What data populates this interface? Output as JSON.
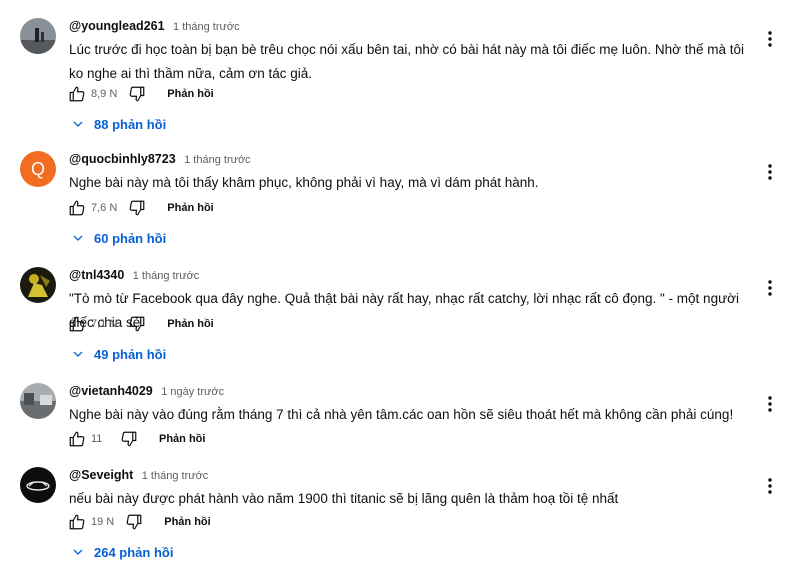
{
  "comments": [
    {
      "author": "@younglead261",
      "time": "1 tháng trước",
      "text": "Lúc trước đi học toàn bị bạn bè trêu chọc nói xấu bên tai, nhờ có bài hát này mà tôi điếc mẹ luôn. Nhờ thế mà tôi ko nghe ai thì thầm nữa, cảm ơn tác giả.",
      "likes": "8,9 N",
      "reply_label": "Phản hồi",
      "replies": "88 phản hồi"
    },
    {
      "author": "@quocbinhly8723",
      "time": "1 tháng trước",
      "avatar_letter": "Q",
      "text": "Nghe bài này mà tôi thấy khâm phục, không phải vì hay, mà vì dám phát hành.",
      "likes": "7,6 N",
      "reply_label": "Phản hồi",
      "replies": "60 phản hồi"
    },
    {
      "author": "@tnl4340",
      "time": "1 tháng trước",
      "text": "\"Tò mò từ Facebook qua đây nghe. Quả thật bài này rất hay, nhạc rất catchy, lời nhạc rất cô đọng. \" - một người điếc chia sẻ",
      "likes": "7,1 N",
      "reply_label": "Phản hồi",
      "replies": "49 phản hồi"
    },
    {
      "author": "@vietanh4029",
      "time": "1 ngày trước",
      "text": "Nghe bài này vào đúng rằm tháng 7 thì cả nhà yên tâm.các oan hồn sẽ siêu thoát hết mà không cần phải cúng!",
      "likes": "11",
      "reply_label": "Phản hồi"
    },
    {
      "author": "@Seveight",
      "time": "1 tháng trước",
      "text": "nếu bài này được phát hành vào năm 1900 thì titanic sẽ bị lãng quên là thảm hoạ tồi tệ nhất",
      "likes": "19 N",
      "reply_label": "Phản hồi",
      "replies": "264 phản hồi"
    }
  ],
  "colors": {
    "link": "#065fd4",
    "secondary": "#606060",
    "q_avatar": "#f26d21"
  },
  "icons": {
    "like": "thumbs-up-icon",
    "dislike": "thumbs-down-icon",
    "expand": "chevron-down-icon",
    "menu": "more-vert-icon"
  }
}
